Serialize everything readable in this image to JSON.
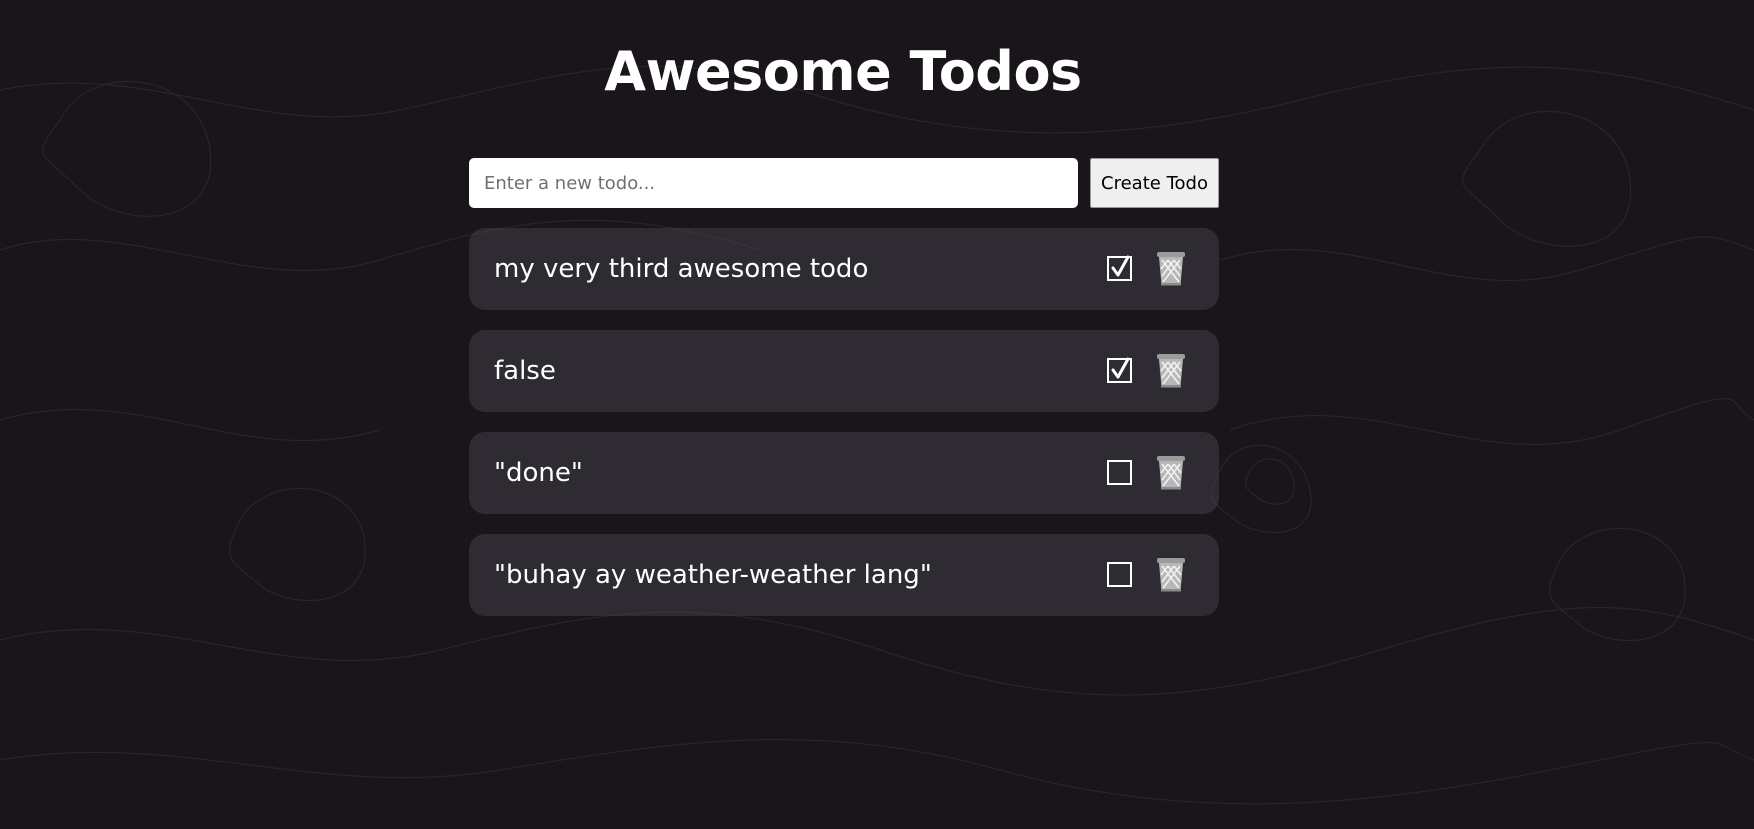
{
  "app": {
    "title": "Awesome Todos"
  },
  "new_todo": {
    "placeholder": "Enter a new todo...",
    "value": "",
    "create_label": "Create Todo"
  },
  "todos": [
    {
      "text": "my very third awesome todo",
      "done": true,
      "delete_icon": "wastebasket-icon"
    },
    {
      "text": "false",
      "done": true,
      "delete_icon": "wastebasket-icon"
    },
    {
      "text": "\"done\"",
      "done": false,
      "delete_icon": "wastebasket-icon"
    },
    {
      "text": "\"buhay ay weather-weather lang\"",
      "done": false,
      "delete_icon": "wastebasket-icon"
    }
  ],
  "colors": {
    "background": "#19151b",
    "card": "#3a3540",
    "text": "#ffffff"
  }
}
